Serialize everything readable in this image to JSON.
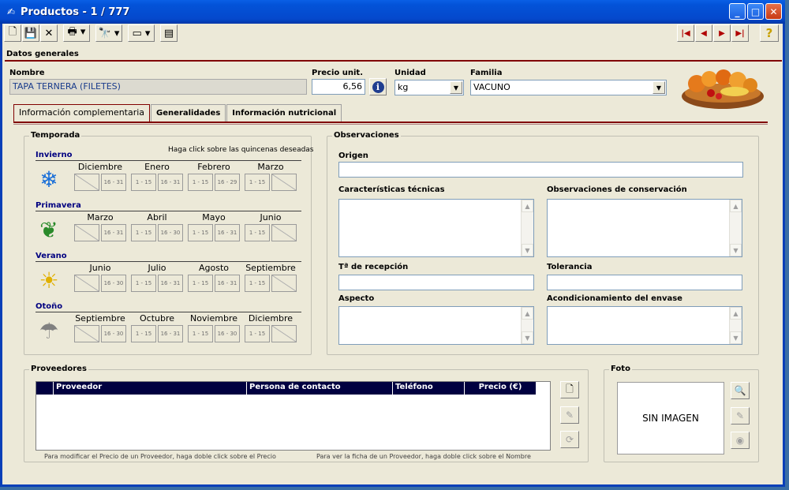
{
  "window": {
    "title": "Productos - 1 / 777"
  },
  "toolbar": {
    "buttons": [
      "new-icon",
      "save-icon",
      "delete-icon",
      "print-icon",
      "search-icon",
      "window-icon",
      "form-icon"
    ],
    "nav": [
      "|◀",
      "◀",
      "▶",
      "▶|"
    ],
    "help": "?"
  },
  "header": {
    "section": "Datos generales",
    "nombre_label": "Nombre",
    "nombre_value": "TAPA TERNERA (FILETES)",
    "precio_label": "Precio unit.",
    "precio_value": "6,56",
    "unidad_label": "Unidad",
    "unidad_value": "kg",
    "familia_label": "Familia",
    "familia_value": "VACUNO"
  },
  "tabs": [
    {
      "label": "Información complementaria"
    },
    {
      "label": "Generalidades"
    },
    {
      "label": "Información nutricional"
    }
  ],
  "temporada": {
    "title": "Temporada",
    "hint": "Haga click sobre las quincenas deseadas",
    "seasons": [
      {
        "name": "Invierno",
        "months": [
          "Diciembre",
          "Enero",
          "Febrero",
          "Marzo"
        ],
        "cells": [
          "",
          "16 - 31",
          "1 - 15",
          "16 - 31",
          "1 - 15",
          "16 - 29",
          "1 - 15",
          ""
        ]
      },
      {
        "name": "Primavera",
        "months": [
          "Marzo",
          "Abril",
          "Mayo",
          "Junio"
        ],
        "cells": [
          "",
          "16 - 31",
          "1 - 15",
          "16 - 30",
          "1 - 15",
          "16 - 31",
          "1 - 15",
          ""
        ]
      },
      {
        "name": "Verano",
        "months": [
          "Junio",
          "Julio",
          "Agosto",
          "Septiembre"
        ],
        "cells": [
          "",
          "16 - 30",
          "1 - 15",
          "16 - 31",
          "1 - 15",
          "16 - 31",
          "1 - 15",
          ""
        ]
      },
      {
        "name": "Otoño",
        "months": [
          "Septiembre",
          "Octubre",
          "Noviembre",
          "Diciembre"
        ],
        "cells": [
          "",
          "16 - 30",
          "1 - 15",
          "16 - 31",
          "1 - 15",
          "16 - 30",
          "1 - 15",
          ""
        ]
      }
    ]
  },
  "observaciones": {
    "title": "Observaciones",
    "origen": "Origen",
    "caracteristicas": "Características técnicas",
    "conservacion": "Observaciones de conservación",
    "recepcion": "Tª de recepción",
    "tolerancia": "Tolerancia",
    "aspecto": "Aspecto",
    "envase": "Acondicionamiento del envase"
  },
  "proveedores": {
    "title": "Proveedores",
    "columns": [
      "Proveedor",
      "Persona de contacto",
      "Teléfono",
      "Precio (€)"
    ],
    "hint_precio": "Para modificar el Precio de un Proveedor, haga doble click sobre el Precio",
    "hint_nombre": "Para ver la ficha de un Proveedor, haga doble click sobre el Nombre"
  },
  "foto": {
    "title": "Foto",
    "placeholder": "SIN IMAGEN"
  }
}
